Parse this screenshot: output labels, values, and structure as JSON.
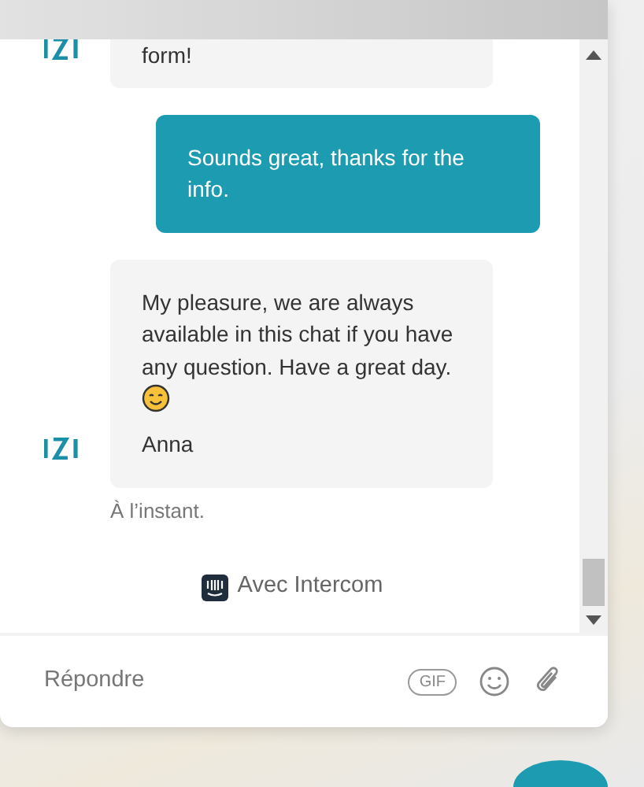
{
  "messages": [
    {
      "kind": "agent",
      "paragraphs": [
        "form!"
      ]
    },
    {
      "kind": "user",
      "paragraphs": [
        "Sounds great, thanks for the info."
      ]
    },
    {
      "kind": "agent",
      "paragraphs": [
        "My pleasure, we are always available in this chat if you have any question. Have a great day."
      ],
      "emoji": true,
      "signature": "Anna",
      "time": "À l’instant."
    }
  ],
  "powered_by": "Avec Intercom",
  "composer": {
    "placeholder": "Répondre",
    "gif_label": "GIF"
  }
}
